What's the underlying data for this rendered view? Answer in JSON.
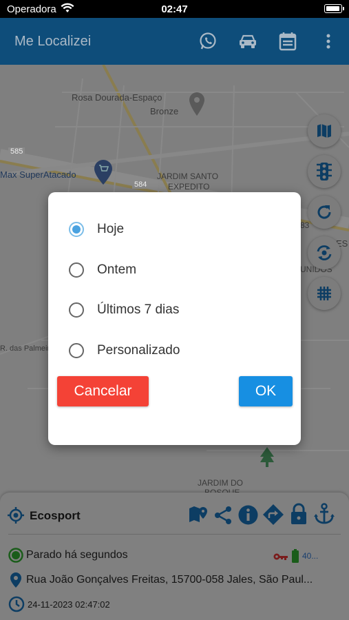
{
  "status_bar": {
    "carrier": "Operadora",
    "time": "02:47"
  },
  "app_bar": {
    "title": "Me Localizei"
  },
  "map": {
    "labels": {
      "poi1": "Rosa Dourada-Espaço",
      "poi1b": "Bronze",
      "road585": "585",
      "store": "Max SuperAtacado",
      "road584": "584",
      "district1": "JARDIM SANTO",
      "district1b": "EXPEDITO",
      "street": "R. das Palmeir",
      "district2": "JARDIM DO",
      "district2b": "BOSQUE",
      "edge1": "ES",
      "edge2": "UNIDOS",
      "edge3": "83"
    }
  },
  "dialog": {
    "options": [
      {
        "label": "Hoje",
        "selected": true
      },
      {
        "label": "Ontem",
        "selected": false
      },
      {
        "label": "Últimos 7 dias",
        "selected": false
      },
      {
        "label": "Personalizado",
        "selected": false
      }
    ],
    "cancel_label": "Cancelar",
    "ok_label": "OK"
  },
  "vehicle_panel": {
    "name": "Ecosport",
    "status": "Parado há segundos",
    "battery_text": "40...",
    "address": "Rua João Gonçalves Freitas, 15700-058 Jales, São Paul...",
    "timestamp": "24-11-2023 02:47:02"
  },
  "colors": {
    "app_bar": "#0e4d7a",
    "radio_selected": "#4aa2e0",
    "cancel_button": "#f44236",
    "ok_button": "#178fe2",
    "icon_blue": "#0d3d63",
    "status_green": "#1a5c1a",
    "key_red": "#7a1c1c"
  }
}
